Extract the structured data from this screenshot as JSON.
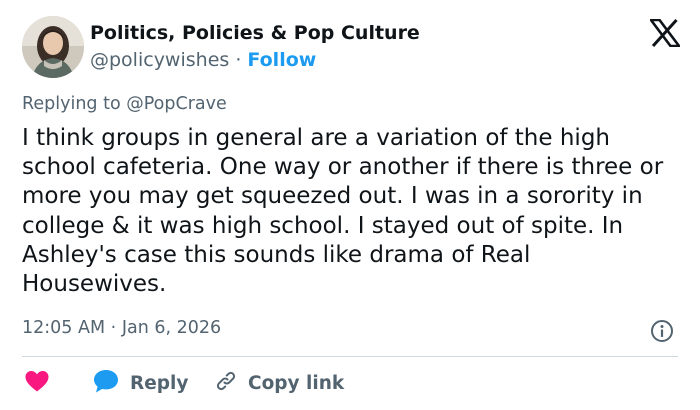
{
  "author": {
    "name": "Politics, Policies & Pop Culture",
    "handle": "@policywishes",
    "separator": "·",
    "follow_label": "Follow"
  },
  "replying": {
    "prefix": "Replying to",
    "mention": "@PopCrave"
  },
  "tweet": {
    "text": "I think groups in general are a variation of the high school cafeteria. One way or another if there is three or more you may get squeezed out. I was in a sorority in college & it was high school. I stayed out of spite. In Ashley's case this sounds like drama of Real Housewives."
  },
  "meta": {
    "time": "12:05 AM",
    "separator": "·",
    "date": "Jan 6, 2026"
  },
  "actions": {
    "reply_label": "Reply",
    "copy_link_label": "Copy link"
  },
  "icons": {
    "logo": "x-logo-icon",
    "info": "info-icon",
    "like": "heart-icon",
    "reply": "speech-bubble-icon",
    "copy_link": "link-icon"
  },
  "colors": {
    "accent": "#1d9bf0",
    "heart": "#f91880",
    "text": "#0f1419",
    "secondary": "#536471",
    "divider": "#cfd9de"
  }
}
